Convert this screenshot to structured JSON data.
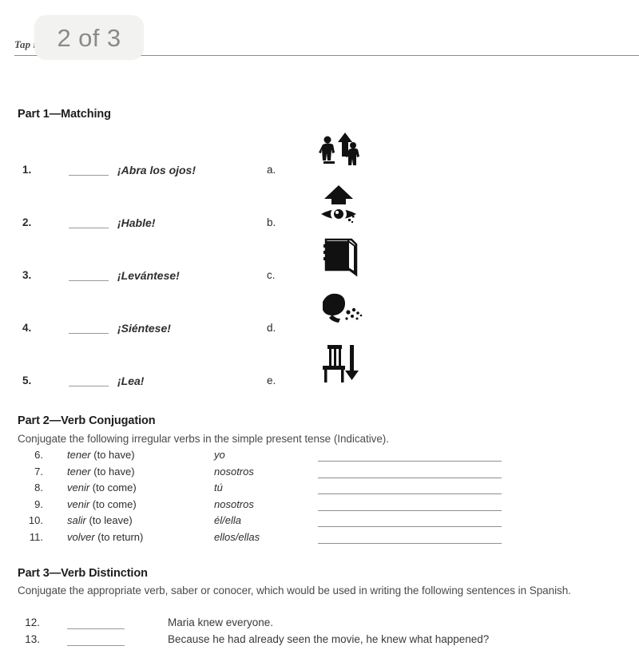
{
  "page_indicator": {
    "label": "2 of 3"
  },
  "header": {
    "text": "Tap                    rtion"
  },
  "part1": {
    "heading": "Part 1—Matching",
    "items": [
      {
        "number": "1.",
        "phrase": "¡Abra los ojos!",
        "letter": "a.",
        "icon": "person-standing-up-arrow-icon"
      },
      {
        "number": "2.",
        "phrase": "¡Hable!",
        "letter": "b.",
        "icon": "eye-up-arrow-icon"
      },
      {
        "number": "3.",
        "phrase": "¡Levántese!",
        "letter": "c.",
        "icon": "book-icon"
      },
      {
        "number": "4.",
        "phrase": "¡Siéntese!",
        "letter": "d.",
        "icon": "head-speaking-icon"
      },
      {
        "number": "5.",
        "phrase": "¡Lea!",
        "letter": "e.",
        "icon": "chair-down-arrow-icon"
      }
    ]
  },
  "part2": {
    "heading": "Part 2—Verb Conjugation",
    "instructions": "Conjugate the following irregular verbs in the simple present tense (Indicative).",
    "items": [
      {
        "number": "6.",
        "infinitive": "tener",
        "gloss": " (to have)",
        "pronoun": "yo"
      },
      {
        "number": "7.",
        "infinitive": "tener",
        "gloss": " (to have)",
        "pronoun": "nosotros"
      },
      {
        "number": "8.",
        "infinitive": "venir",
        "gloss": " (to come)",
        "pronoun": "tú"
      },
      {
        "number": "9.",
        "infinitive": "venir",
        "gloss": " (to come)",
        "pronoun": "nosotros"
      },
      {
        "number": "10.",
        "infinitive": "salir",
        "gloss": " (to leave)",
        "pronoun": "él/ella"
      },
      {
        "number": "11.",
        "infinitive": "volver",
        "gloss": " (to return)",
        "pronoun": "ellos/ellas"
      }
    ]
  },
  "part3": {
    "heading": "Part 3—Verb Distinction",
    "instructions": "Conjugate the appropriate verb, saber or conocer, which would be used in writing the following sentences in Spanish.",
    "items": [
      {
        "number": "12.",
        "sentence": "Maria knew everyone."
      },
      {
        "number": "13.",
        "sentence": "Because he had already seen the movie, he knew what happened?"
      }
    ]
  },
  "colors": {
    "page_background": "#ffffff",
    "body_text": "#3a3a3a",
    "heading_text": "#1d1d1d",
    "rule": "#8c8c8c",
    "blank_line": "#9a9a9a",
    "indicator_background": "#f2f2f1",
    "indicator_text": "#8a8a8a"
  }
}
